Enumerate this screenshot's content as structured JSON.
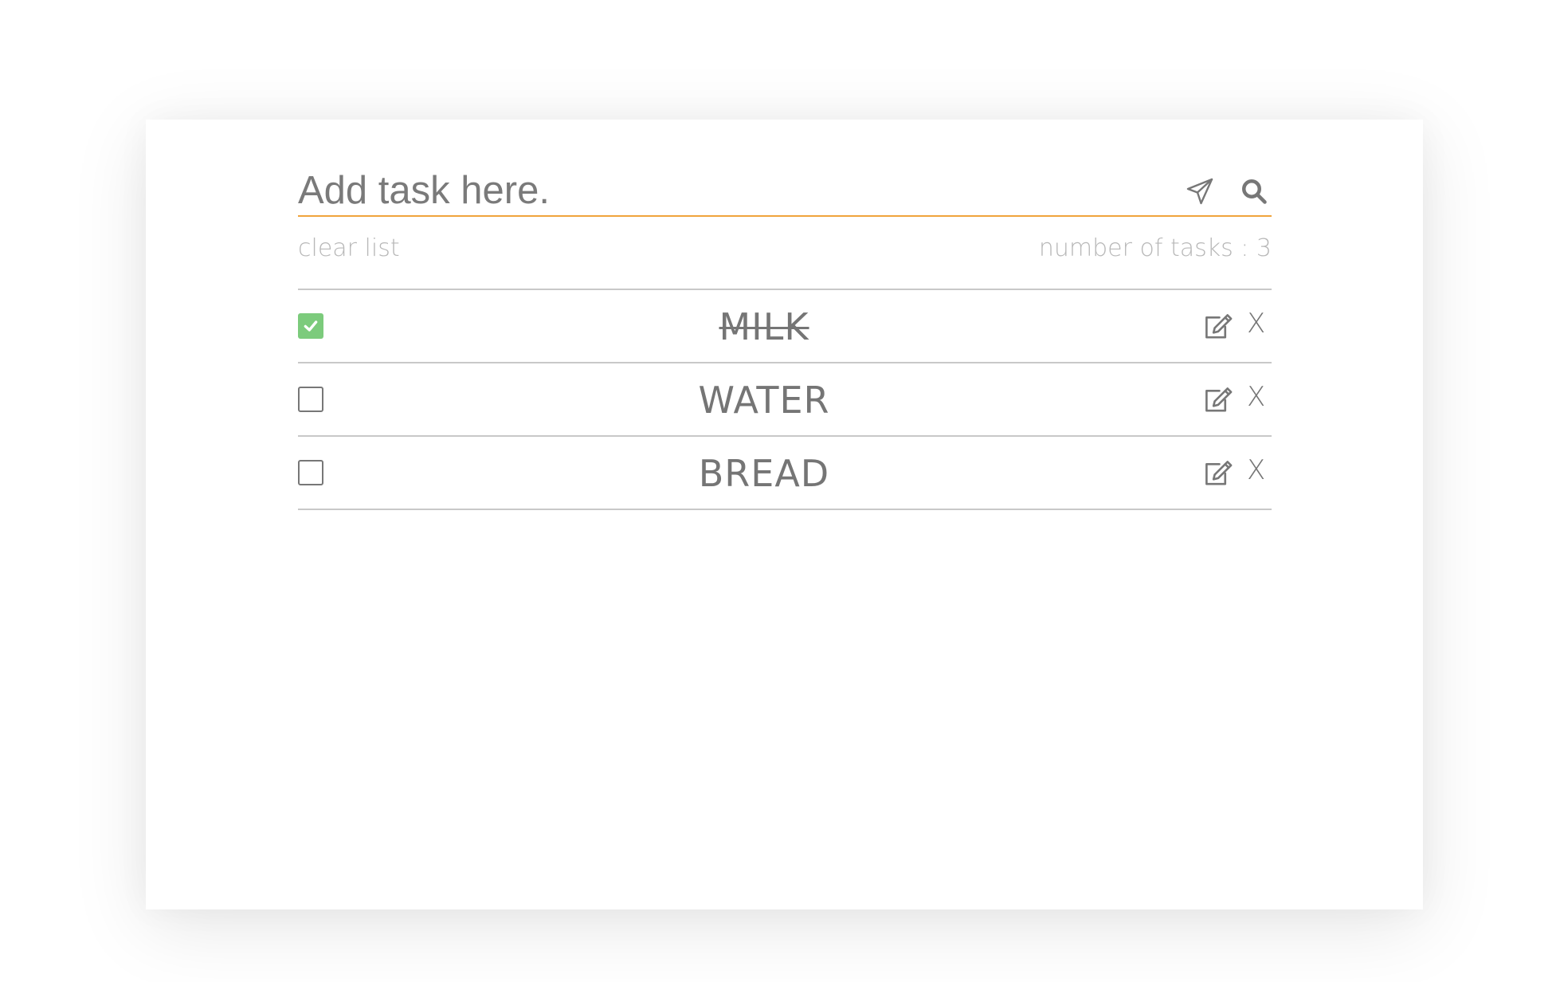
{
  "input": {
    "placeholder": "Add task here.",
    "value": ""
  },
  "icons": {
    "send": "paper-plane-icon",
    "search": "search-icon",
    "edit": "edit-icon",
    "check": "check-icon"
  },
  "meta": {
    "clear_label": "clear list",
    "count_label": "number of tasks : 3"
  },
  "tasks": [
    {
      "text": "MILK",
      "done": true,
      "delete_label": "X"
    },
    {
      "text": "WATER",
      "done": false,
      "delete_label": "X"
    },
    {
      "text": "BREAD",
      "done": false,
      "delete_label": "X"
    }
  ],
  "colors": {
    "accent": "#f0a43c",
    "checked": "#7ccb7c",
    "text": "#757575",
    "muted": "#b8b8b8"
  }
}
